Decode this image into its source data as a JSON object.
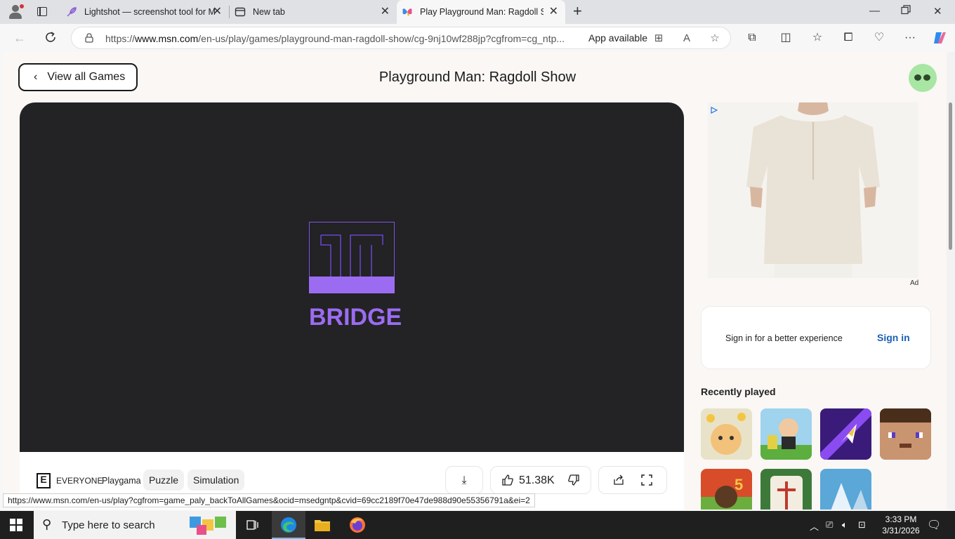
{
  "browser": {
    "tabs": [
      {
        "label": "Lightshot — screenshot tool for M",
        "icon": "feather-icon"
      },
      {
        "label": "New tab",
        "icon": "newtab-icon"
      },
      {
        "label": "Play Playground Man: Ragdoll Sho",
        "icon": "butterfly-icon",
        "active": true
      }
    ],
    "url_prefix": "https://",
    "url_domain": "www.msn.com",
    "url_rest": "/en-us/play/games/playground-man-ragdoll-show/cg-9nj10wf288jp?cgfrom=cg_ntp...",
    "app_available": "App available"
  },
  "page": {
    "back_label": "View all Games",
    "title": "Playground Man: Ragdoll Show",
    "game_logo_text": "BRIDGE",
    "rating_letter": "E",
    "rating": "EVERYONE",
    "publisher": "Playgama",
    "tags": [
      "Puzzle",
      "Simulation"
    ],
    "likes": "51.38K",
    "ad_label": "Ad",
    "signin_text": "Sign in for a better experience",
    "signin_link": "Sign in",
    "recently_played": "Recently played",
    "status_url": "https://www.msn.com/en-us/play?cgfrom=game_paly_backToAllGames&ocid=msedgntp&cvid=69cc2189f70e47de988d90e55356791a&ei=2"
  },
  "taskbar": {
    "search_placeholder": "Type here to search",
    "time": "3:33 PM",
    "date": "3/31/2026"
  },
  "colors": {
    "accent_purple": "#9b6cf2",
    "game_bg": "#232224",
    "link_blue": "#1a5fb4"
  }
}
